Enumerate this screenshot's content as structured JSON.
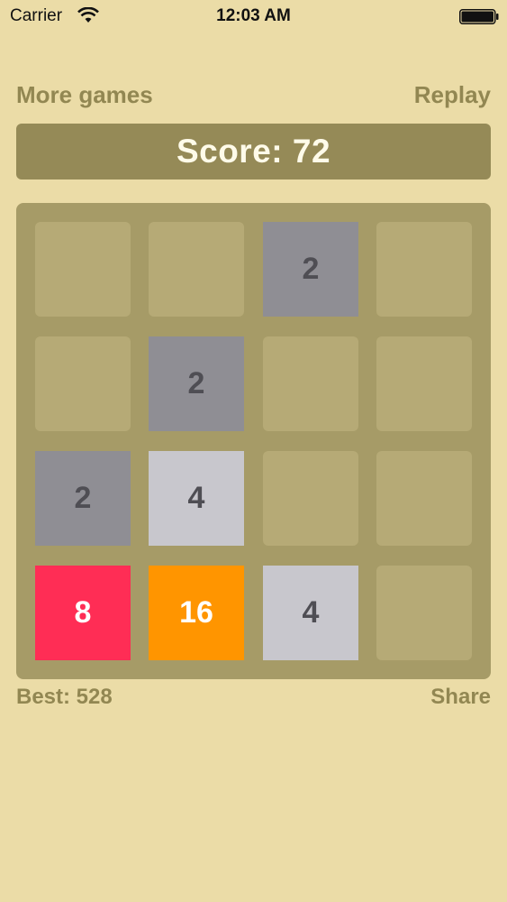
{
  "status_bar": {
    "carrier": "Carrier",
    "time": "12:03 AM",
    "wifi_icon": "wifi-icon",
    "battery_icon": "battery-icon"
  },
  "header": {
    "more_games": "More games",
    "replay": "Replay"
  },
  "score": {
    "text": "Score: 72"
  },
  "board": {
    "rows": [
      [
        "",
        "",
        "2",
        ""
      ],
      [
        "",
        "2",
        "",
        ""
      ],
      [
        "2",
        "4",
        "",
        ""
      ],
      [
        "8",
        "16",
        "4",
        ""
      ]
    ]
  },
  "footer": {
    "best": "Best: 528",
    "share": "Share"
  },
  "colors": {
    "background": "#ebdca7",
    "accent_text": "#928752",
    "score_bar": "#958a57",
    "board": "#a69b67",
    "empty_cell": "#b6aa76",
    "tile_2": "#8f8e94",
    "tile_4": "#c8c7cd",
    "tile_8": "#ff2d55",
    "tile_16": "#ff9500"
  }
}
